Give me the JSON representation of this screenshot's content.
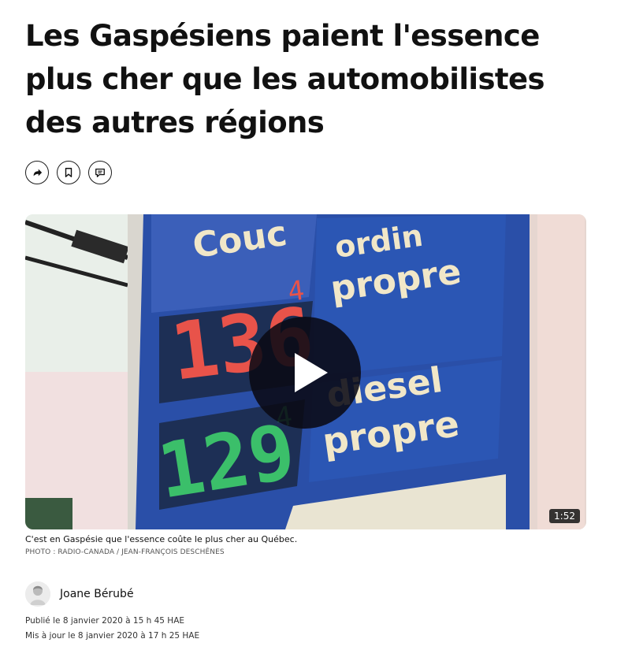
{
  "article": {
    "title": "Les Gaspésiens paient l'essence plus cher que les automobilistes des autres régions"
  },
  "actions": [
    {
      "icon": "share-icon"
    },
    {
      "icon": "bookmark-icon"
    },
    {
      "icon": "comment-icon"
    }
  ],
  "media": {
    "sign_text": {
      "brand": "Couc",
      "regular_1": "ordin",
      "regular_2": "propre",
      "diesel_1": "diesel",
      "diesel_2": "propre",
      "price_1": "136",
      "price_1_tenth": "4",
      "price_2": "129",
      "price_2_tenth": "4"
    },
    "duration": "1:52"
  },
  "caption": "C'est en Gaspésie que l'essence coûte le plus cher au Québec.",
  "credit": "PHOTO : RADIO-CANADA / JEAN-FRANÇOIS DESCHÊNES",
  "author": {
    "name": "Joane Bérubé"
  },
  "published": "Publié le 8 janvier 2020 à 15 h 45 HAE",
  "updated": "Mis à jour le 8 janvier 2020 à 17 h 25 HAE",
  "colors": {
    "sign_blue": "#2a4fa8",
    "price_red": "#e8534a",
    "price_green": "#3bbf6a"
  }
}
